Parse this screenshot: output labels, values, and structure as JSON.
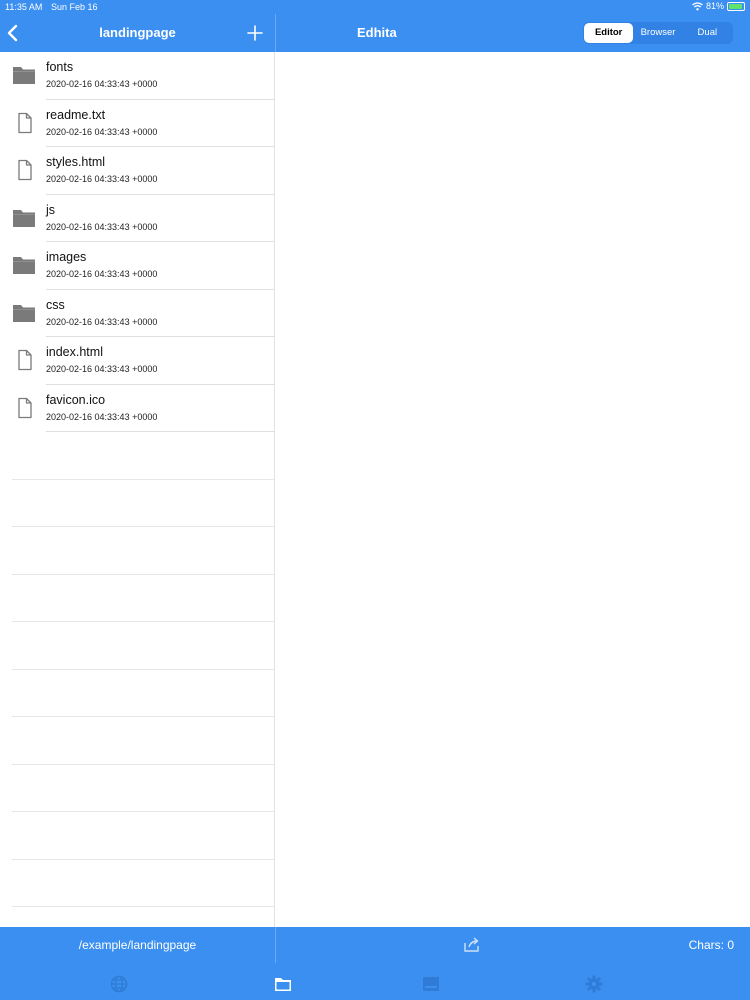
{
  "status_bar": {
    "time": "11:35 AM",
    "date": "Sun Feb 16",
    "battery": "81%",
    "battery_level": 0.81
  },
  "file_browser": {
    "title": "landingpage",
    "items": [
      {
        "name": "fonts",
        "modified": "2020-02-16 04:33:43 +0000",
        "type": "folder"
      },
      {
        "name": "readme.txt",
        "modified": "2020-02-16 04:33:43 +0000",
        "type": "file"
      },
      {
        "name": "styles.html",
        "modified": "2020-02-16 04:33:43 +0000",
        "type": "file"
      },
      {
        "name": "js",
        "modified": "2020-02-16 04:33:43 +0000",
        "type": "folder"
      },
      {
        "name": "images",
        "modified": "2020-02-16 04:33:43 +0000",
        "type": "folder"
      },
      {
        "name": "css",
        "modified": "2020-02-16 04:33:43 +0000",
        "type": "folder"
      },
      {
        "name": "index.html",
        "modified": "2020-02-16 04:33:43 +0000",
        "type": "file"
      },
      {
        "name": "favicon.ico",
        "modified": "2020-02-16 04:33:43 +0000",
        "type": "file"
      }
    ],
    "path": "/example/landingpage"
  },
  "editor": {
    "title": "Edhita",
    "modes": [
      "Editor",
      "Browser",
      "Dual"
    ],
    "selected_mode": "Editor",
    "chars_label": "Chars: 0"
  },
  "tab_bar": {
    "tabs": [
      {
        "icon": "globe-icon"
      },
      {
        "icon": "folder-icon",
        "selected": true
      },
      {
        "icon": "keyboard-icon"
      },
      {
        "icon": "gear-icon"
      }
    ]
  },
  "colors": {
    "accent": "#3a8ff0",
    "icon_gray": "#7a7a7a"
  }
}
